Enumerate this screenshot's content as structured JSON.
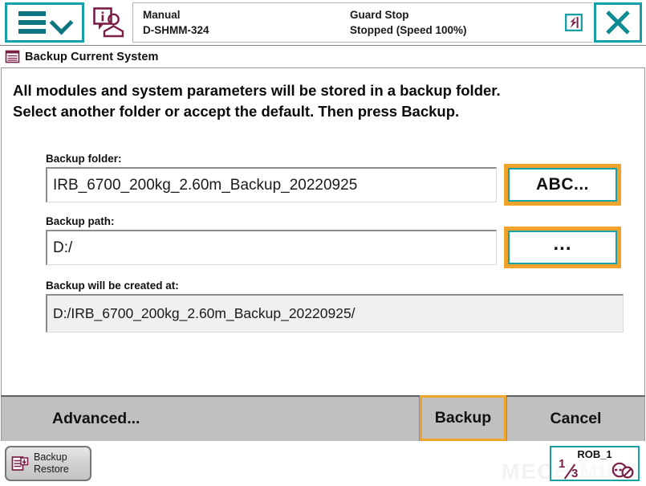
{
  "header": {
    "menu_icon": "hamburger-chevron-icon",
    "user_info_icon": "info-user-icon",
    "operating_mode_label": "Manual",
    "controller_name": "D-SHMM-324",
    "guard_state_label": "Guard Stop",
    "run_state_label": "Stopped (Speed 100%)",
    "warning_icon": "motors-off-icon",
    "close_icon": "close-x-icon"
  },
  "window": {
    "icon": "backup-restore-icon",
    "title": "Backup Current System"
  },
  "main": {
    "instructions_line1": "All modules and system parameters will be stored in a backup folder.",
    "instructions_line2": "Select another folder or accept the default. Then press Backup.",
    "fields": {
      "folder": {
        "label": "Backup folder:",
        "value": "IRB_6700_200kg_2.60m_Backup_20220925",
        "button_label": "ABC..."
      },
      "path": {
        "label": "Backup path:",
        "value": "D:/",
        "button_label": "..."
      },
      "result": {
        "label": "Backup will be created at:",
        "value": "D:/IRB_6700_200kg_2.60m_Backup_20220925/"
      }
    }
  },
  "action_bar": {
    "advanced_label": "Advanced...",
    "backup_label": "Backup",
    "cancel_label": "Cancel"
  },
  "taskbar": {
    "app_icon": "backup-restore-icon",
    "app_label_line1": "Backup",
    "app_label_line2": "Restore",
    "watermark": "MECH MIND",
    "robot": {
      "name": "ROB_1",
      "numerator": "1",
      "denominator": "3",
      "status_icon": "motors-disabled-icon"
    }
  },
  "colors": {
    "teal": "#18a0a8",
    "teal_dark": "#0d7680",
    "orange": "#f0a32a",
    "maroon": "#7b1f47",
    "bar_gray": "#c0c0c0"
  }
}
